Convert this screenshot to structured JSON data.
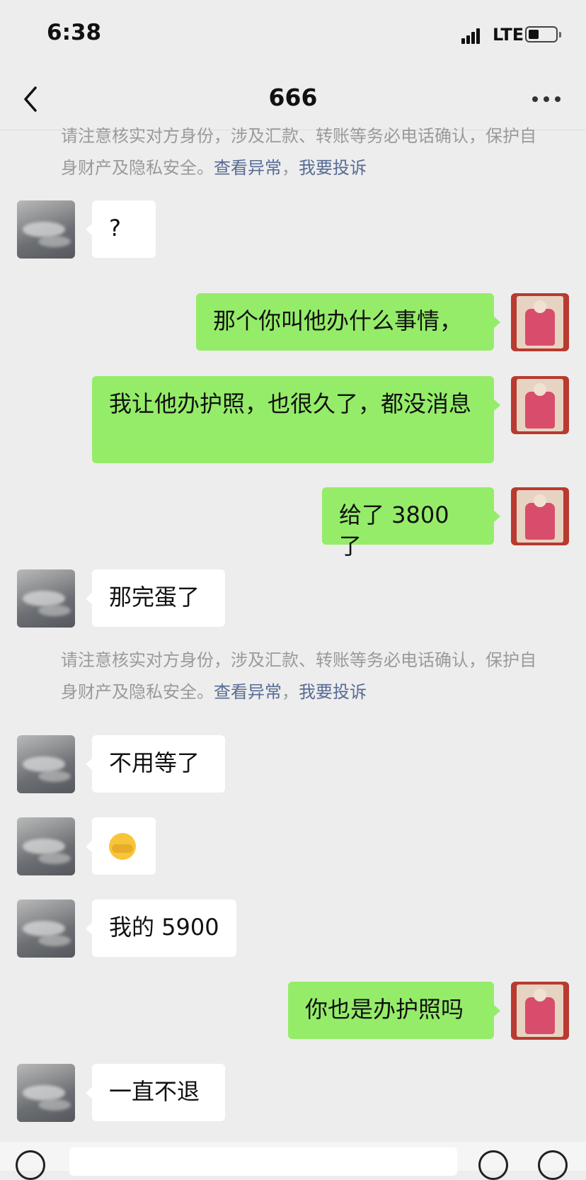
{
  "status_bar": {
    "time": "6:38",
    "network": "LTE"
  },
  "header": {
    "title": "666"
  },
  "notice": {
    "text": "请注意核实对方身份，涉及汇款、转账等务必电话确认，保护自身财产及隐私安全。",
    "link1": "查看异常",
    "separator": "，",
    "link2": "我要投诉"
  },
  "messages": [
    {
      "from": "them",
      "text": "?"
    },
    {
      "from": "me",
      "text": "那个你叫他办什么事情，"
    },
    {
      "from": "me",
      "text": "我让他办护照，也很久了，都没消息"
    },
    {
      "from": "me",
      "text": "给了 3800 了"
    },
    {
      "from": "them",
      "text": "那完蛋了"
    },
    {
      "from": "them",
      "text": "不用等了"
    },
    {
      "from": "them",
      "emoji": "facepalm-emoji"
    },
    {
      "from": "them",
      "text": "我的 5900"
    },
    {
      "from": "me",
      "text": "你也是办护照吗"
    },
    {
      "from": "them",
      "text": "一直不退"
    }
  ]
}
